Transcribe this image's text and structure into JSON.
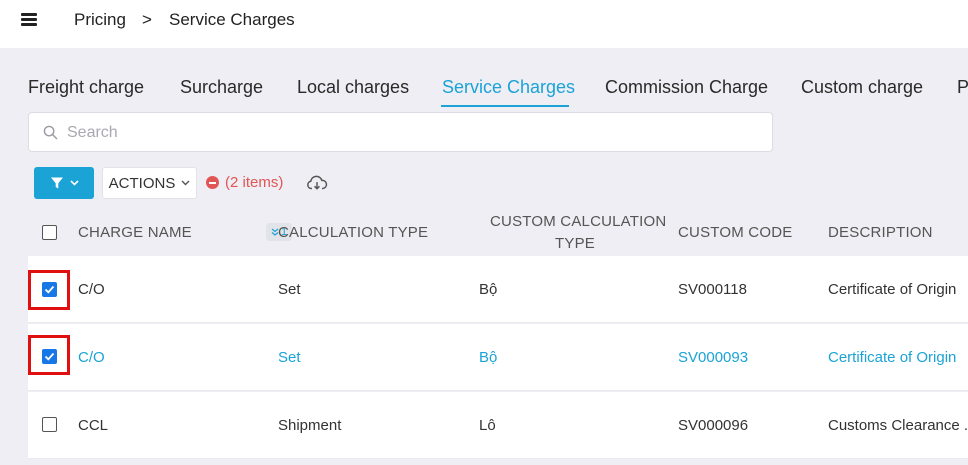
{
  "header": {
    "breadcrumb": [
      "Pricing",
      ">",
      "Service Charges"
    ]
  },
  "tabs": [
    {
      "label": "Freight charge",
      "active": false
    },
    {
      "label": "Surcharge",
      "active": false
    },
    {
      "label": "Local charges",
      "active": false
    },
    {
      "label": "Service Charges",
      "active": true
    },
    {
      "label": "Commission Charge",
      "active": false
    },
    {
      "label": "Custom charge",
      "active": false
    },
    {
      "label": "P",
      "active": false
    }
  ],
  "search": {
    "placeholder": "Search",
    "value": ""
  },
  "toolbar": {
    "actions_label": "ACTIONS",
    "selected_label": "(2 items)"
  },
  "table": {
    "columns": [
      "CHARGE NAME",
      "CALCULATION TYPE",
      "CUSTOM CALCULATION",
      "TYPE",
      "CUSTOM CODE",
      "DESCRIPTION"
    ],
    "sort_badge": "1",
    "rows": [
      {
        "charge_name": "C/O",
        "calculation_type": "Set",
        "custom_calc_type": "Bộ",
        "custom_code": "SV000118",
        "description": "Certificate of Origin",
        "checked": true
      },
      {
        "charge_name": "C/O",
        "calculation_type": "Set",
        "custom_calc_type": "Bộ",
        "custom_code": "SV000093",
        "description": "Certificate of Origin",
        "checked": true
      },
      {
        "charge_name": "CCL",
        "calculation_type": "Shipment",
        "custom_calc_type": "Lô",
        "custom_code": "SV000096",
        "description": "Customs Clearance ...",
        "checked": false
      }
    ]
  },
  "colors": {
    "accent": "#1ba3d6",
    "checkbox": "#1877e6",
    "danger": "#e25555",
    "highlight_box": "#e01010"
  }
}
